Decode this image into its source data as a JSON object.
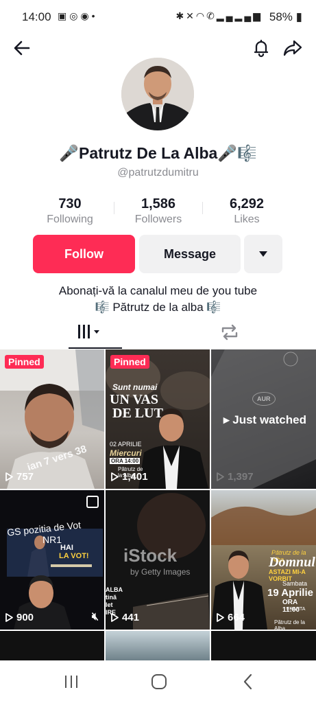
{
  "status_bar": {
    "time": "14:00",
    "battery": "58%",
    "left_icons": [
      "gallery-icon",
      "whatsapp-icon",
      "messenger-icon",
      "dot-icon"
    ],
    "right_icons": [
      "bluetooth-icon",
      "mute-icon",
      "wifi-icon",
      "call-icon",
      "signal-icon",
      "signal-icon"
    ]
  },
  "profile": {
    "name": "🎤Patrutz De La Alba🎤🎼",
    "handle": "@patrutzdumitru"
  },
  "stats": [
    {
      "value": "730",
      "label": "Following"
    },
    {
      "value": "1,586",
      "label": "Followers"
    },
    {
      "value": "6,292",
      "label": "Likes"
    }
  ],
  "actions": {
    "follow": "Follow",
    "message": "Message"
  },
  "bio": {
    "line1": "Abonați-vă la canalul meu de you tube",
    "line2": "🎼 Pătrutz de la alba 🎼"
  },
  "videos": [
    {
      "pinned": "Pinned",
      "views": "757",
      "overlay": "ian 7 vers 38"
    },
    {
      "pinned": "Pinned",
      "views": "1,401",
      "headline1": "Sunt numai",
      "headline2": "UN VAS",
      "headline3": "DE LUT",
      "date": "02 APRILIE",
      "day": "Miercuri",
      "hour": "ORA 14:00",
      "brand": "Pătrutz de la Alba"
    },
    {
      "views": "1,397",
      "overlay": "Just watched",
      "stamp": "AUR"
    },
    {
      "views": "900",
      "overlay1": "GS pozitia de Vot",
      "overlay2": "NR1",
      "banner1": "HAI",
      "banner2": "LA VOT!"
    },
    {
      "views": "441",
      "watermark": "iStock",
      "watermark2": "by Getty Images",
      "side1": "ALBA",
      "side2": "tină",
      "side3": "let",
      "side4": "IRE"
    },
    {
      "views": "664",
      "brand": "Pătrutz de la Alba",
      "title": "Domnul",
      "subtitle": "ASTAZI MI-A VORBIT",
      "day": "Sambata",
      "date": "19 Aprilie",
      "hour": "ORA 11:00",
      "place": "FRANTA",
      "footer": "Pătrutz de la Alba"
    }
  ]
}
